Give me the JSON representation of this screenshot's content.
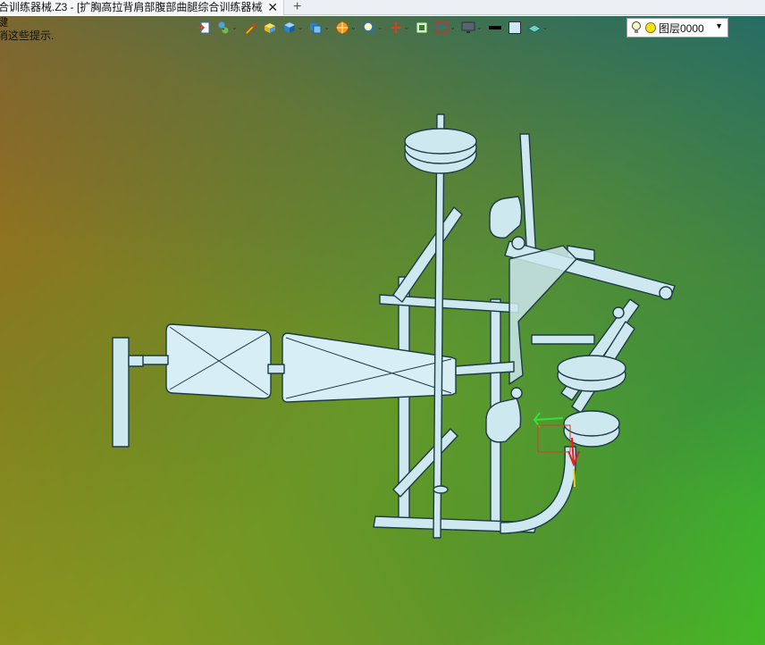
{
  "tab": {
    "title": "合训练器械.Z3 - [扩胸高拉背肩部腹部曲腿综合训练器械]",
    "close_symbol": "✕",
    "add_symbol": "+"
  },
  "hints": {
    "line1": "键",
    "line2": "消这些提示."
  },
  "toolbar": {
    "buttons": [
      "exit-sketch-icon",
      "assembly-icon",
      "paint-brush-icon",
      "shaded-box-icon",
      "cube-view-icon",
      "display-mode-icon",
      "render-ball-icon",
      "zoom-fit-icon",
      "move-axis-icon",
      "component-icon",
      "section-icon",
      "monitor-icon",
      "line-color-icon",
      "fill-color-icon",
      "surface-icon"
    ]
  },
  "layer": {
    "name": "图层0000"
  },
  "colors": {
    "model_fill": "#cde8ef",
    "model_line": "#1e3b45",
    "accent_green": "#2ec42e",
    "accent_brown": "#a3611e"
  }
}
